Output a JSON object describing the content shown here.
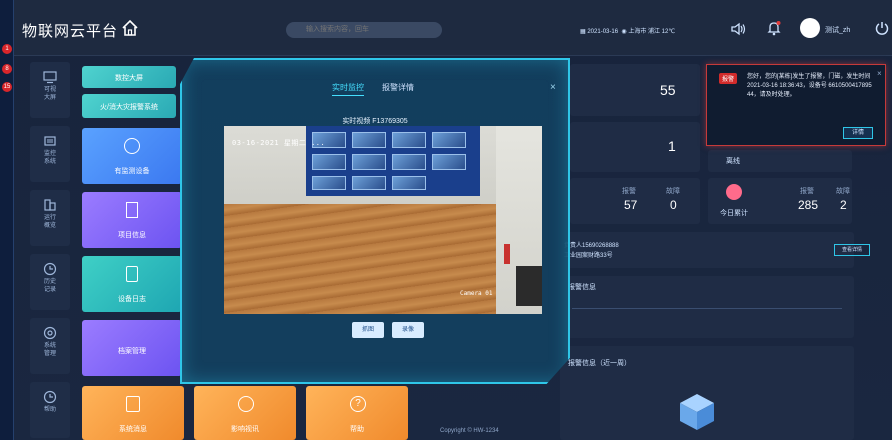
{
  "app": {
    "title": "物联网云平台"
  },
  "header": {
    "search_placeholder": "输入搜索内容，回车",
    "date": "2021-03-16",
    "location": "上海市 浦江 12℃",
    "user": "测试_zh"
  },
  "sidebar": {
    "items": [
      {
        "label_line1": "可视",
        "label_line2": "大屏",
        "icon": "monitor-icon"
      },
      {
        "label_line1": "监控",
        "label_line2": "系统",
        "icon": "camera-icon"
      },
      {
        "label_line1": "运行",
        "label_line2": "概览",
        "icon": "building-icon"
      },
      {
        "label_line1": "历史",
        "label_line2": "记录",
        "icon": "clock-icon"
      },
      {
        "label_line1": "系统",
        "label_line2": "管理",
        "icon": "settings-icon"
      },
      {
        "label_line1": "帮助",
        "label_line2": "",
        "icon": "clock-icon"
      }
    ]
  },
  "tiles": {
    "t1": "数控大屏",
    "t2": "火/消大灾报警系统",
    "t3": "有监测设备",
    "t4": "项目信息",
    "t5": "设备日志",
    "t6": "档案管理",
    "t7": "系统消息",
    "t8": "影响视讯",
    "t9": "帮助"
  },
  "stats": {
    "s1": "55",
    "s2": "1",
    "s3_label": "离线",
    "alarm_label": "报警",
    "fault_label": "故障",
    "alarm_val": "57",
    "fault_val": "0",
    "today_label": "今日累计",
    "today_alarm": "285",
    "today_fault": "2",
    "contact": "负责人15690268888",
    "address": "工业园案财路33号",
    "detail_btn": "查看详情",
    "section_alarm_info": "报警信息",
    "section_recent": "报警信息（近一周）"
  },
  "modal": {
    "tab_live": "实时监控",
    "tab_detail": "报警详情",
    "video_title": "实时视频 F13769305",
    "osd": "03-16-2021 星期二 ...",
    "camera_label": "Camera 01",
    "btn_capture": "抓图",
    "btn_record": "录像",
    "close": "×"
  },
  "alarm_popup": {
    "badge": "报警",
    "text": "您好，您的[某栋]发生了报警，门磁，发生时间2021-03-16 18:36:43，设备号 6610500417895 44，请及时处理。",
    "button": "详情"
  },
  "footer": {
    "copyright": "Copyright © HW-1234"
  }
}
